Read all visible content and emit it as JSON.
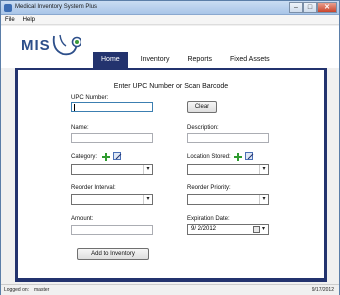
{
  "window": {
    "title": "Medical Inventory System Plus",
    "minimize": "–",
    "maximize": "□",
    "close": "✕"
  },
  "menu": {
    "items": [
      "File",
      "Help"
    ]
  },
  "logo": {
    "text": "MIS"
  },
  "tabs": [
    "Home",
    "Inventory",
    "Reports",
    "Fixed Assets"
  ],
  "form": {
    "heading": "Enter UPC Number or Scan Barcode",
    "upc_label": "UPC Number:",
    "upc_value": "",
    "clear_label": "Clear",
    "name_label": "Name:",
    "name_value": "",
    "description_label": "Description:",
    "description_value": "",
    "category_label": "Category:",
    "category_value": "",
    "location_label": "Location Stored:",
    "location_value": "",
    "reorder_interval_label": "Reorder Interval:",
    "reorder_interval_value": "",
    "reorder_priority_label": "Reorder Priority:",
    "reorder_priority_value": "",
    "amount_label": "Amount:",
    "amount_value": "",
    "expiration_label": "Expiration Date:",
    "expiration_value": "9/  2/2012",
    "add_label": "Add to Inventory"
  },
  "status": {
    "logged_on_label": "Logged on:",
    "user": "master",
    "date": "9/17/2012"
  },
  "icons": {
    "add": "plus-icon",
    "edit": "edit-icon",
    "calendar": "calendar-icon"
  },
  "colors": {
    "accent": "#23336e",
    "logo": "#2d4f8a",
    "add_icon": "#2e9b2e"
  }
}
